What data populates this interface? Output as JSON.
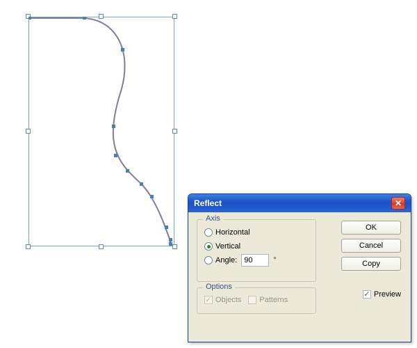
{
  "dialog": {
    "title": "Reflect",
    "axis": {
      "legend": "Axis",
      "horizontal": "Horizontal",
      "vertical": "Vertical",
      "angle_label": "Angle:",
      "angle_value": "90",
      "selected": "vertical"
    },
    "options": {
      "legend": "Options",
      "objects": "Objects",
      "patterns": "Patterns",
      "objects_checked": true
    },
    "buttons": {
      "ok": "OK",
      "cancel": "Cancel",
      "copy": "Copy"
    },
    "preview": {
      "label": "Preview",
      "checked": true
    }
  }
}
